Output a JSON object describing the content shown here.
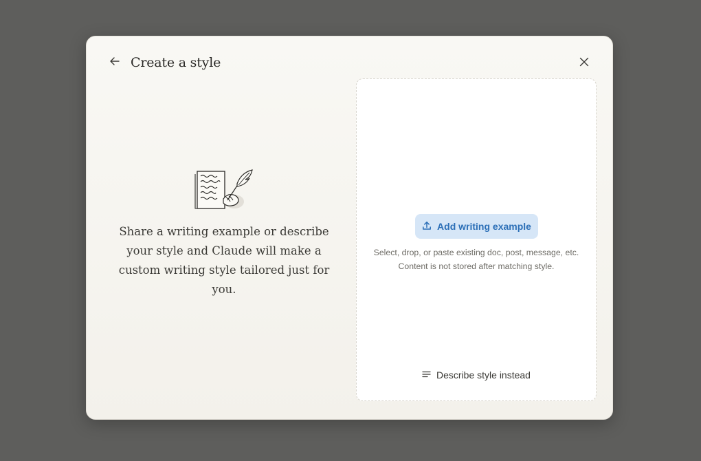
{
  "dialog": {
    "title": "Create a style",
    "back_icon": "arrow-left-icon",
    "close_icon": "close-icon"
  },
  "intro": {
    "illustration_icon": "quill-writing-illustration",
    "text": "Share a writing example or describe your style and Claude will make a custom writing style tailored just for you."
  },
  "upload": {
    "button_label": "Add writing example",
    "button_icon": "upload-icon",
    "hint_line1": "Select, drop, or paste existing doc, post, message, etc.",
    "hint_line2": "Content is not stored after matching style.",
    "describe_label": "Describe style instead",
    "describe_icon": "text-lines-icon"
  },
  "colors": {
    "backdrop": "#5e5e5c",
    "modal_bg": "#f9f8f4",
    "accent_button_bg": "#d6e6f7",
    "accent_button_text": "#2c6fb7"
  }
}
